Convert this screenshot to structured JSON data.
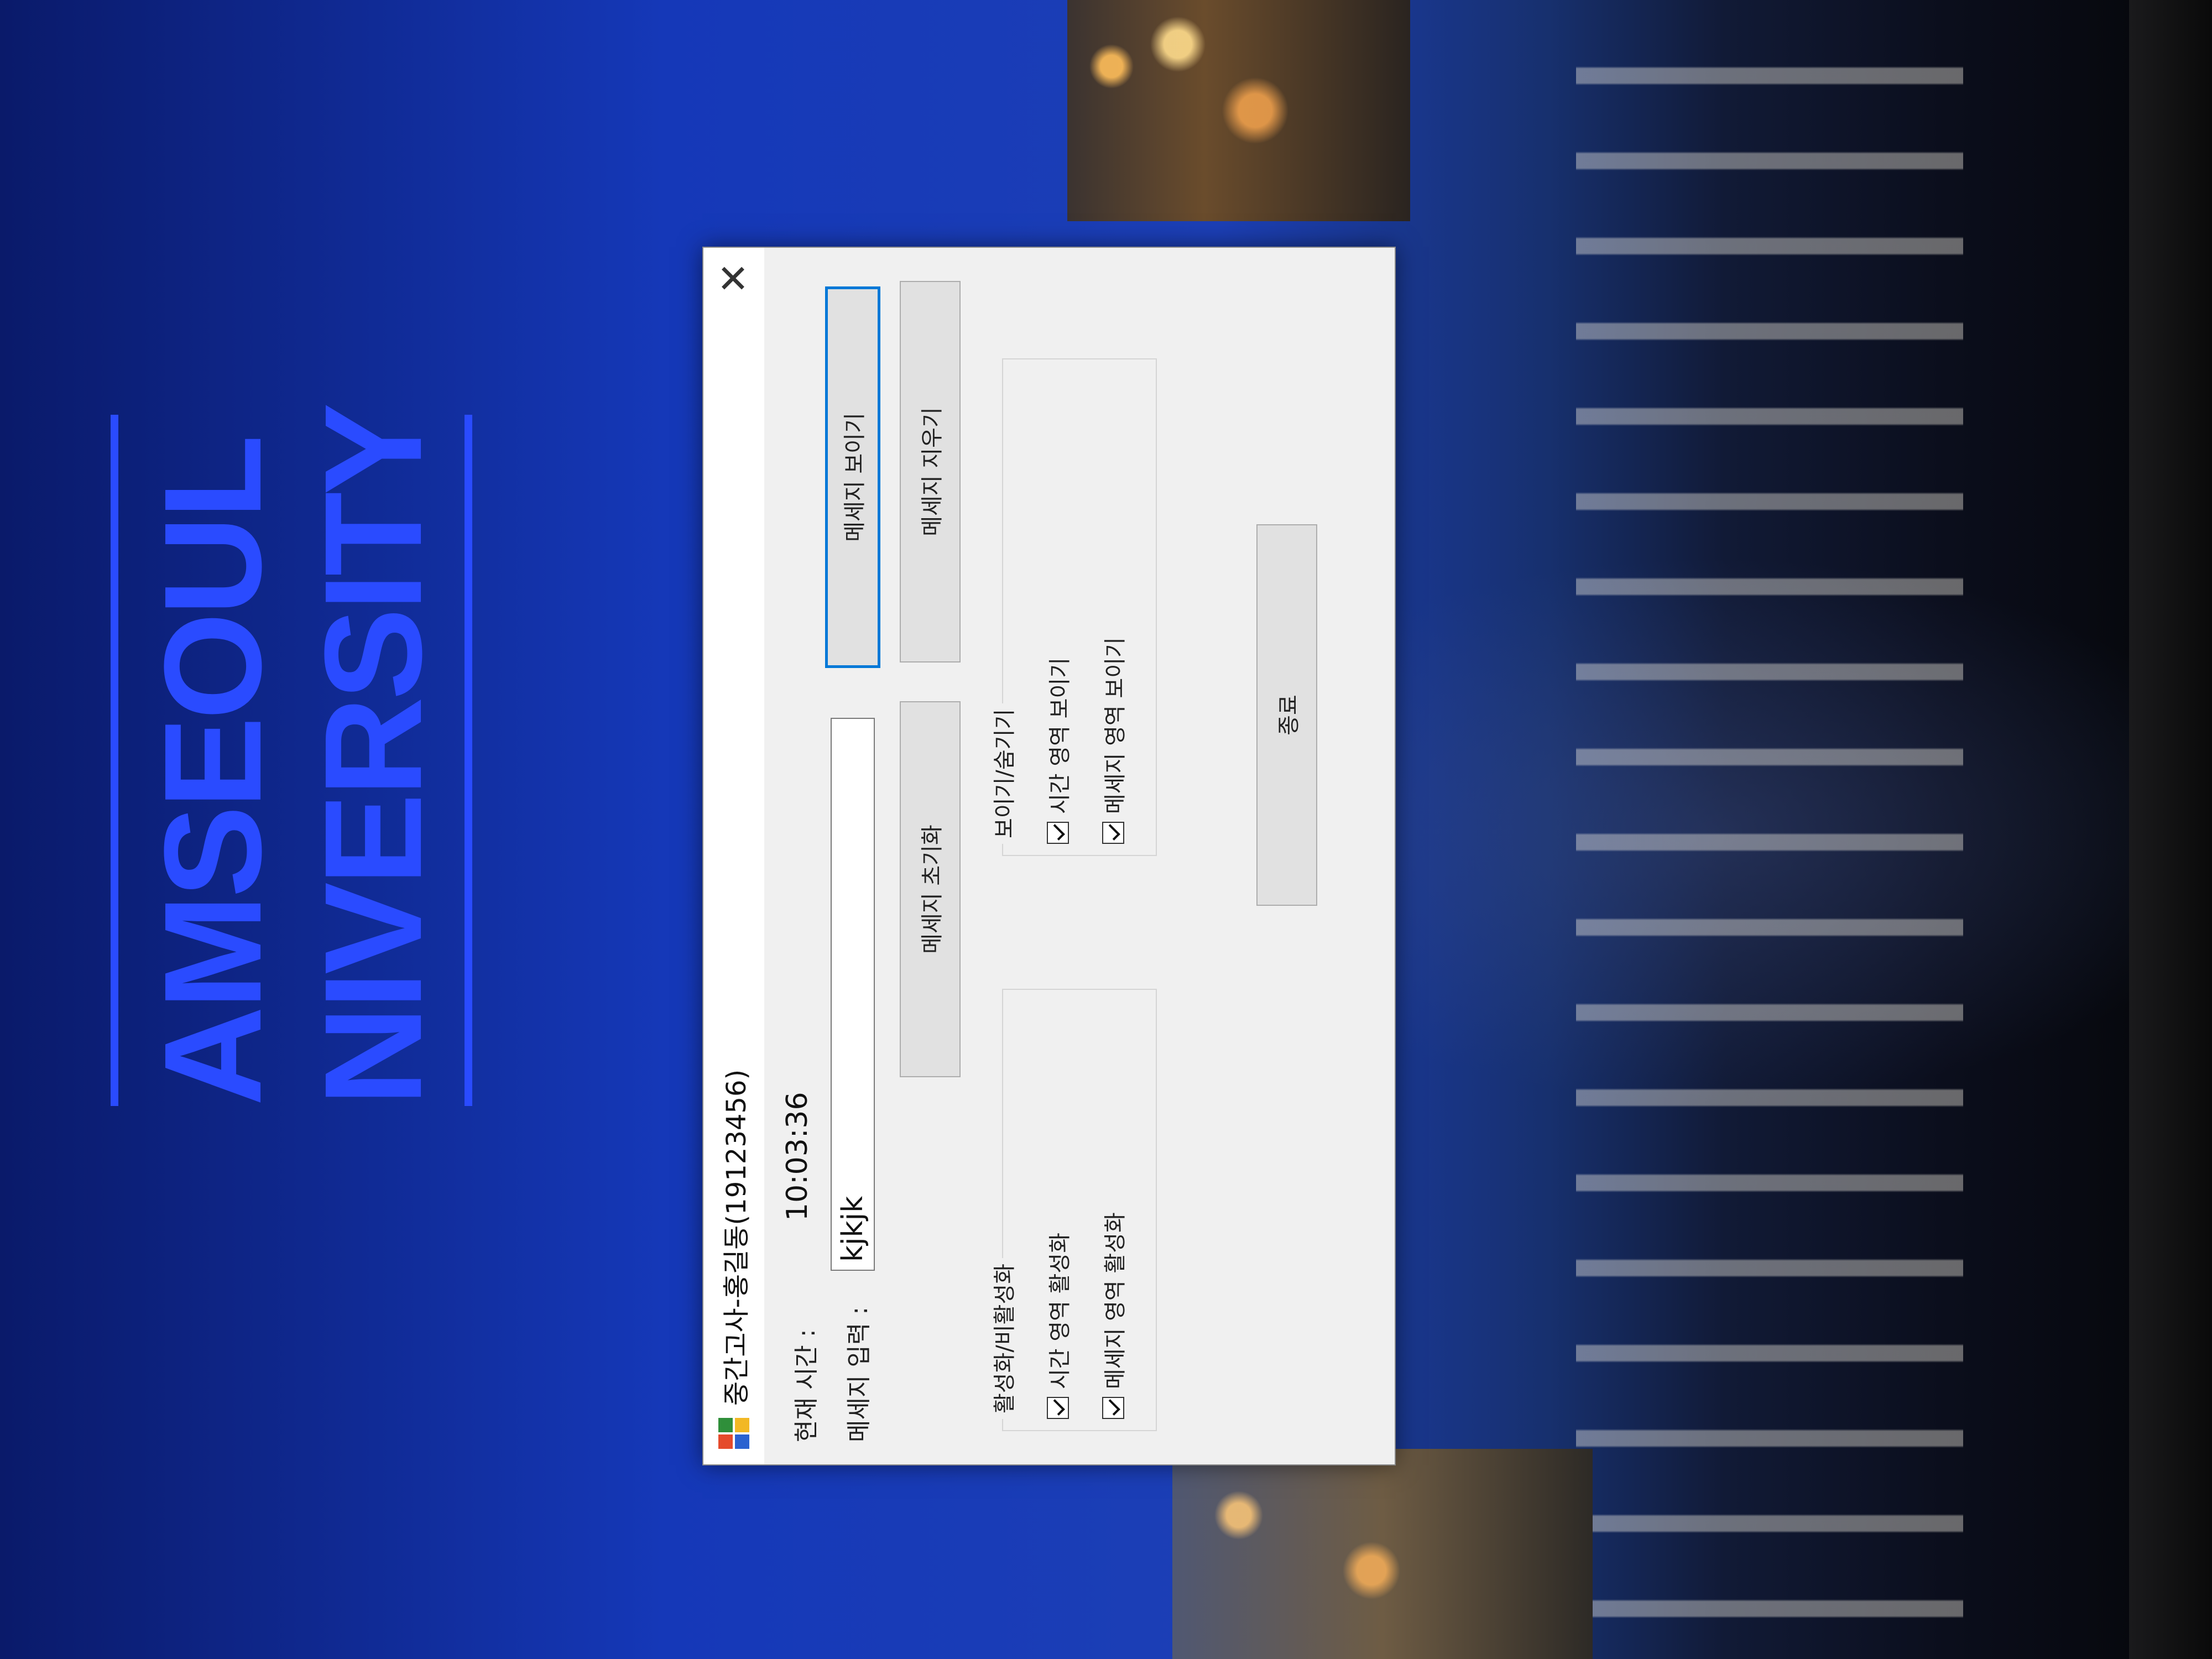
{
  "background": {
    "university_line1": "AMSEOUL",
    "university_line2": "NIVERSITY",
    "accent_color": "#2a4bff"
  },
  "dialog": {
    "title": "중간고사-홍길동(19123456)",
    "app_icon": "colorful-app-icon",
    "close_icon": "close-icon",
    "time_label": "현재 시간 :",
    "time_value": "10:03:36",
    "message_label": "메세지 입력 :",
    "message_value": "kjkjk",
    "buttons": {
      "show_message": "메세지 보이기",
      "reset_message": "메세지 초기화",
      "clear_message": "메세지 지우기",
      "exit": "종료"
    },
    "enable_group": {
      "title": "활성화/비활성화",
      "options": [
        {
          "label": "시간 영역 활성화",
          "checked": true
        },
        {
          "label": "메세지 영역 활성화",
          "checked": true
        }
      ]
    },
    "visibility_group": {
      "title": "보이기/숨기기",
      "options": [
        {
          "label": "시간 영역 보이기",
          "checked": true
        },
        {
          "label": "메세지 영역 보이기",
          "checked": true
        }
      ]
    }
  }
}
